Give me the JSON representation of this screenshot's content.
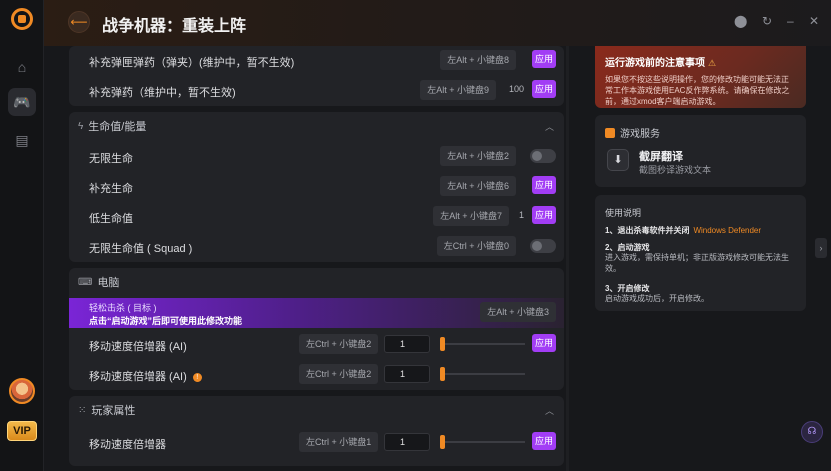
{
  "window": {
    "title": "战争机器：重装上阵",
    "back_icon": "arrow-left-icon",
    "controls": [
      "record-icon",
      "refresh-icon",
      "minimize-icon",
      "close-icon"
    ]
  },
  "rail": {
    "items": [
      {
        "name": "home",
        "icon": "home-icon",
        "glyph": "⌂"
      },
      {
        "name": "games",
        "icon": "gamepad-icon",
        "glyph": "🎮"
      },
      {
        "name": "storage",
        "icon": "box-icon",
        "glyph": "▤"
      }
    ],
    "vip": "VIP"
  },
  "sections": {
    "ammo": {
      "rows": [
        {
          "label": "补充弹匣弹药（弹夹）(维护中，暂不生效)",
          "hotkey": "左Alt + 小键盘8",
          "apply": "应用"
        },
        {
          "label": "补充弹药（维护中，暂不生效)",
          "hotkey": "左Alt + 小键盘9",
          "value": "100",
          "apply": "应用"
        }
      ]
    },
    "health": {
      "title": "生命值/能量",
      "rows": [
        {
          "label": "无限生命",
          "hotkey": "左Alt + 小键盘2",
          "control": "toggle"
        },
        {
          "label": "补充生命",
          "hotkey": "左Alt + 小键盘6",
          "apply": "应用"
        },
        {
          "label": "低生命值",
          "hotkey": "左Alt + 小键盘7",
          "value": "1",
          "apply": "应用"
        },
        {
          "label": "无限生命值 ( Squad )",
          "hotkey": "左Ctrl + 小键盘0",
          "control": "toggle"
        }
      ]
    },
    "computer": {
      "title": "电脑",
      "highlight": {
        "label": "轻松击杀 ( 目标 )",
        "hint": "点击“启动游戏”后即可使用此修改功能",
        "hotkey": "左Alt + 小键盘3"
      },
      "rows": [
        {
          "label": "移动速度倍增器 (AI)",
          "hotkey": "左Ctrl + 小键盘2",
          "input": "1",
          "apply": "应用"
        },
        {
          "label": "移动速度倍增器 (AI)",
          "hotkey": "左Ctrl + 小键盘2",
          "input": "1"
        }
      ]
    },
    "player": {
      "title": "玩家属性",
      "rows": [
        {
          "label": "移动速度倍增器",
          "hotkey": "左Ctrl + 小键盘1",
          "input": "1",
          "apply": "应用"
        }
      ]
    }
  },
  "notice": {
    "title": "运行游戏前的注意事项",
    "body": "如果您不按这些说明操作，您的修改功能可能无法正常工作本游戏使用EAC反作弊系统。请确保在修改之前，通过xmod客户端启动游戏。"
  },
  "service": {
    "title": "游戏服务",
    "name": "截屏翻译",
    "desc": "截图秒译游戏文本"
  },
  "guide": {
    "title": "使用说明",
    "step1": "1、退出杀毒软件并关闭",
    "step1_highlight": "Windows Defender",
    "step2": "2、启动游戏",
    "step2_text": "进入游戏，需保持单机；非正版游戏修改可能无法生效。",
    "step3": "3、开启修改",
    "step3_text": "启动游戏成功后，开启修改。"
  },
  "colors": {
    "accent": "#f08a24",
    "apply_purple": "#a23df5",
    "panel": "#222327"
  }
}
